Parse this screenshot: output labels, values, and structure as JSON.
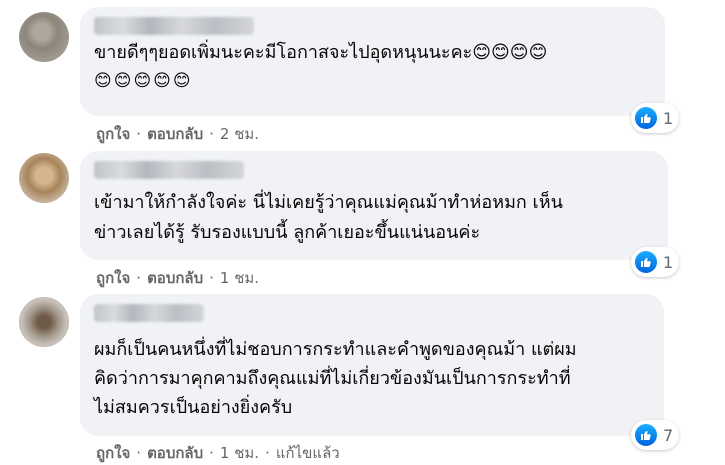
{
  "like_label": "ถูกใจ",
  "reply_label": "ตอบกลับ",
  "separator": "·",
  "comments": [
    {
      "lines": [
        "ขายดีๆๆยอดเพิ่มนะคะมีโอกาสจะไปอุดหนุนนะคะ😊😊😊😊",
        "😊😊😊😊😊"
      ],
      "reaction_count": "1",
      "time": "2 ชม.",
      "edited": ""
    },
    {
      "lines": [
        "เข้ามาให้กำลังใจค่ะ นี่ไม่เคยรู้ว่าคุณแม่คุณม้าทำห่อหมก เห็น",
        "ข่าวเลยได้รู้ รับรองแบบนี้ ลูกค้าเยอะขึ้นแน่นอนค่ะ"
      ],
      "reaction_count": "1",
      "time": "1 ชม.",
      "edited": ""
    },
    {
      "lines": [
        "ผมก็เป็นคนหนึ่งที่ไม่ชอบการกระทำและคำพูดของคุณม้า แต่ผม",
        "คิดว่าการมาคุกคามถึงคุณแม่ที่ไม่เกี่ยวข้องมันเป็นการกระทำที่",
        "ไม่สมควรเป็นอย่างยิ่งครับ"
      ],
      "reaction_count": "7",
      "time": "1 ชม.",
      "edited": "แก้ไขแล้ว"
    }
  ],
  "colors": {
    "bubble": "#f0f2f5",
    "meta_text": "#65676b",
    "like_blue": "#0f7cf2"
  },
  "icons": [
    "thumbs-up-icon",
    "avatar-blurred"
  ]
}
